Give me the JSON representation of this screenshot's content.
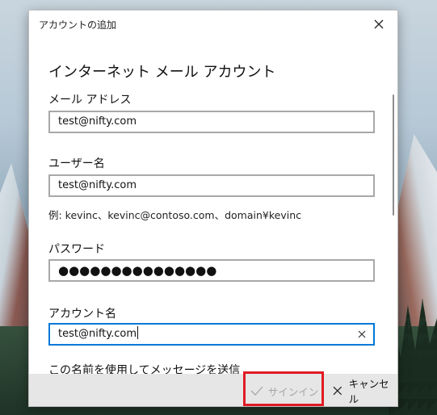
{
  "dialog": {
    "window_title": "アカウントの追加",
    "heading": "インターネット メール アカウント"
  },
  "form": {
    "email_label": "メール アドレス",
    "email_value": "test@nifty.com",
    "username_label": "ユーザー名",
    "username_value": "test@nifty.com",
    "username_hint": "例: kevinc、kevinc@contoso.com、domain¥kevinc",
    "password_label": "パスワード",
    "password_value": "●●●●●●●●●●●●●●●",
    "account_name_label": "アカウント名",
    "account_name_value": "test@nifty.com",
    "send_as_label": "この名前を使用してメッセージを送信"
  },
  "footer": {
    "signin_label": "サインイン",
    "signin_enabled": false,
    "cancel_label": "キャンセル"
  },
  "colors": {
    "focus_border": "#0078d7",
    "highlight": "#e01b24",
    "disabled_text": "#a6a6a6"
  }
}
